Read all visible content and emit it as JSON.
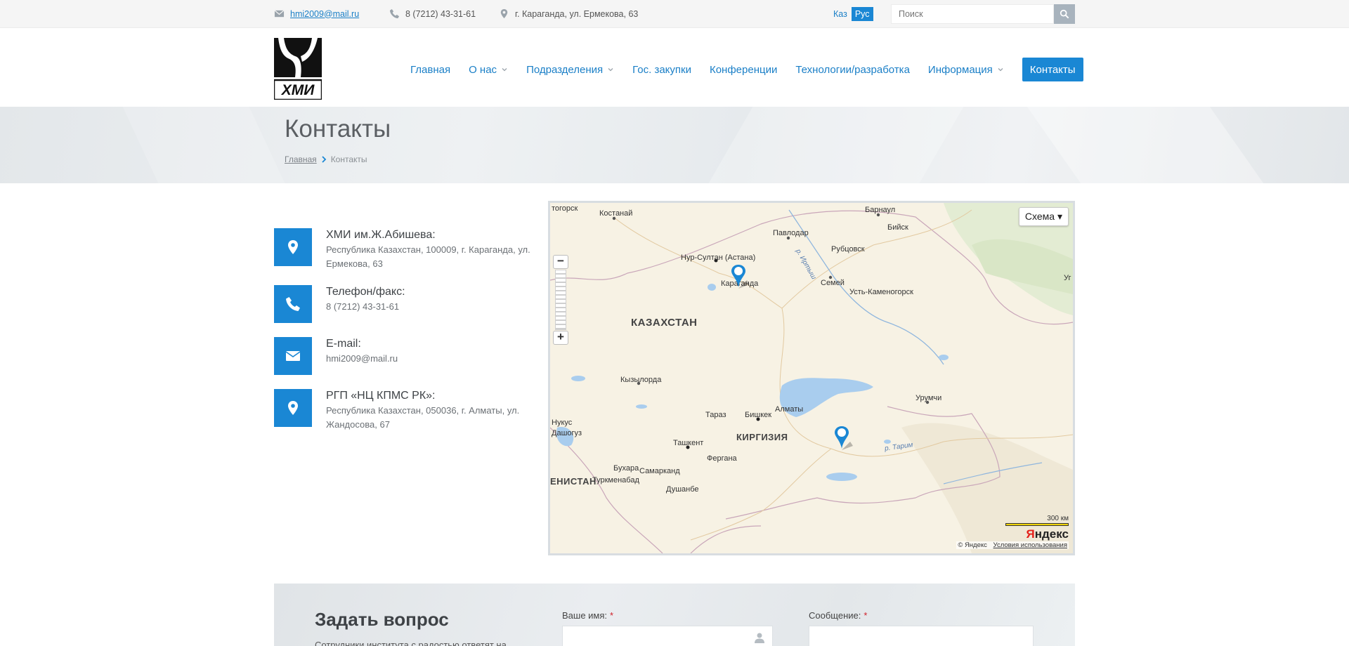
{
  "topbar": {
    "email": "hmi2009@mail.ru",
    "phone": "8 (7212) 43-31-61",
    "address": "г. Караганда, ул. Ермекова, 63",
    "lang_kaz": "Каз",
    "lang_rus": "Рус",
    "search_placeholder": "Поиск"
  },
  "logo_text": "ХМИ",
  "nav": {
    "items": [
      {
        "label": "Главная"
      },
      {
        "label": "О нас"
      },
      {
        "label": "Подразделения"
      },
      {
        "label": "Гос. закупки"
      },
      {
        "label": "Конференции"
      },
      {
        "label": "Технологии/разработка"
      },
      {
        "label": "Информация"
      },
      {
        "label": "Контакты"
      }
    ]
  },
  "page": {
    "title": "Контакты",
    "breadcrumb_home": "Главная",
    "breadcrumb_current": "Контакты"
  },
  "contacts": [
    {
      "label": "ХМИ им.Ж.Абишева:",
      "value": "Республика Казахстан, 100009, г. Караганда, ул. Ермекова, 63",
      "icon": "map-marker-icon"
    },
    {
      "label": "Телефон/факс:",
      "value": "8 (7212) 43-31-61",
      "icon": "phone-icon"
    },
    {
      "label": "E-mail:",
      "value": "hmi2009@mail.ru",
      "icon": "envelope-icon"
    },
    {
      "label": "РГП «НЦ КПМС РК»:",
      "value": "Республика Казахстан, 050036, г. Алматы, ул. Жандосова, 67",
      "icon": "map-marker-icon"
    }
  ],
  "map": {
    "scheme_button": "Схема ▾",
    "scale_label": "300 км",
    "brand_y": "Я",
    "brand_rest": "ндекс",
    "copyright": "© Яндекс",
    "terms": "Условия использования",
    "labels": {
      "togorsk": "тогорск",
      "kostanay": "Костанай",
      "barnaul": "Барнаул",
      "biysk": "Бийск",
      "pavlodar": "Павлодар",
      "rubtsovsk": "Рубцовск",
      "astana": "Нур-Султан (Астана)",
      "karaganda": "Караганда",
      "irtysh": "р. Иртыш",
      "semey": "Семей",
      "ust": "Усть-Каменогорск",
      "kazakhstan": "КАЗАХСТАН",
      "kyzylorda": "Кызылорда",
      "urumqi": "Урумчи",
      "almaty": "Алматы",
      "nukus": "Нукус",
      "dashoguz": "Дашогуз",
      "taraz": "Тараз",
      "bishkek": "Бишкек",
      "kyrgyzstan": "КИРГИЗИЯ",
      "tashkent": "Ташкент",
      "tarim": "р. Тарим",
      "fergana": "Фергана",
      "bukhara": "Бухара",
      "samarkand": "Самарканд",
      "turkmenistan": "ЕНИСТАН",
      "turkmenabad": "Туркменабад",
      "dushanbe": "Душанбе",
      "ug": "Уг"
    }
  },
  "question": {
    "title": "Задать вопрос",
    "subtitle": "Сотрудники института с радостью ответят на",
    "name_label": "Ваше имя:",
    "message_label": "Сообщение:",
    "required_mark": "*"
  },
  "colors": {
    "accent": "#1a87d4",
    "link": "#1a7fc7"
  }
}
